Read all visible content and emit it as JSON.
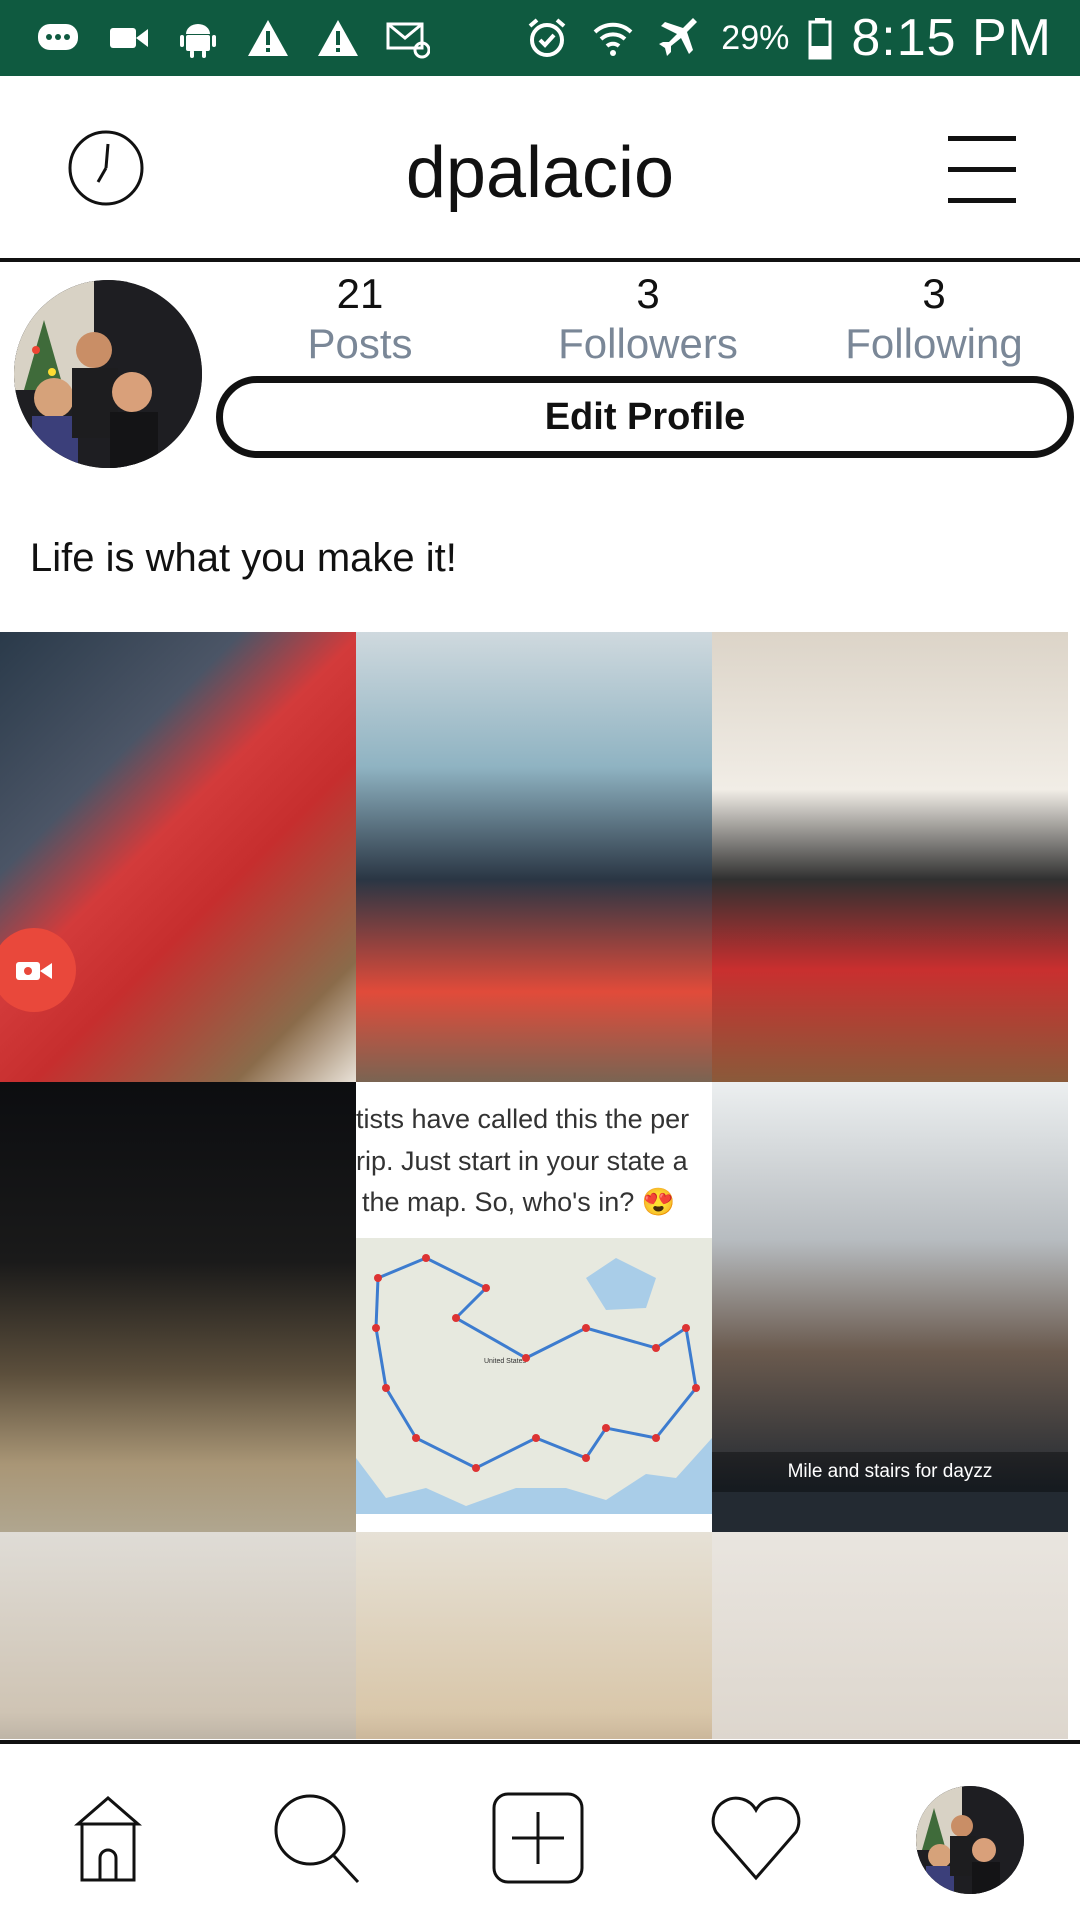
{
  "status_bar": {
    "left_icons": [
      "message-icon",
      "video-icon",
      "android-icon",
      "warning-icon",
      "warning-icon",
      "email-icon"
    ],
    "right_icons": [
      "alarm-icon",
      "wifi-icon",
      "airplane-icon"
    ],
    "battery_percent": "29%",
    "time": "8:15 PM"
  },
  "header": {
    "username": "dpalacio"
  },
  "profile": {
    "stats": [
      {
        "value": "21",
        "label": "Posts"
      },
      {
        "value": "3",
        "label": "Followers"
      },
      {
        "value": "3",
        "label": "Following"
      }
    ],
    "edit_button": "Edit Profile",
    "bio": "Life is what you make it!"
  },
  "grid": {
    "map_post_lines": [
      "tists have called this the per",
      "rip. Just start in your state a",
      "the map. So, who's in? 😍"
    ],
    "map_label": "United States",
    "caption": "Mile and stairs for dayzz"
  },
  "bottom_nav": {
    "items": [
      "home-icon",
      "search-icon",
      "add-post-icon",
      "heart-icon",
      "profile-avatar"
    ]
  },
  "colors": {
    "status_bar": "#0f5a40",
    "stat_label": "#7a8797",
    "record_badge": "#e9483b"
  }
}
